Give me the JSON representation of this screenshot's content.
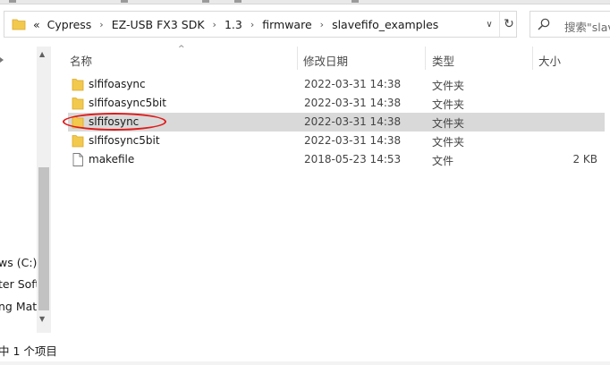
{
  "address": {
    "back_glyph": "«",
    "crumbs": [
      "Cypress",
      "EZ-USB FX3 SDK",
      "1.3",
      "firmware",
      "slavefifo_examples"
    ],
    "separator": "›",
    "dropdown_glyph": "∨",
    "refresh_glyph": "↻"
  },
  "search": {
    "placeholder": "搜索\"slav"
  },
  "nav": {
    "items": [
      "ws (C:)",
      "ter Soft",
      "ng Mate"
    ]
  },
  "columns": {
    "name": "名称",
    "date": "修改日期",
    "type": "类型",
    "size": "大小",
    "sort_glyph": "^"
  },
  "files": [
    {
      "name": "slfifoasync",
      "date": "2022-03-31 14:38",
      "type": "文件夹",
      "size": "",
      "icon": "folder-icon"
    },
    {
      "name": "slfifoasync5bit",
      "date": "2022-03-31 14:38",
      "type": "文件夹",
      "size": "",
      "icon": "folder-icon"
    },
    {
      "name": "slfifosync",
      "date": "2022-03-31 14:38",
      "type": "文件夹",
      "size": "",
      "icon": "folder-icon",
      "selected": true
    },
    {
      "name": "slfifosync5bit",
      "date": "2022-03-31 14:38",
      "type": "文件夹",
      "size": "",
      "icon": "folder-icon"
    },
    {
      "name": "makefile",
      "date": "2018-05-23 14:53",
      "type": "文件",
      "size": "2 KB",
      "icon": "file-icon"
    }
  ],
  "status": {
    "text": "中 1 个项目"
  },
  "colors": {
    "folder": "#f2c94c",
    "selection": "#d9d9d9",
    "highlight_ring": "#e01b1b"
  }
}
